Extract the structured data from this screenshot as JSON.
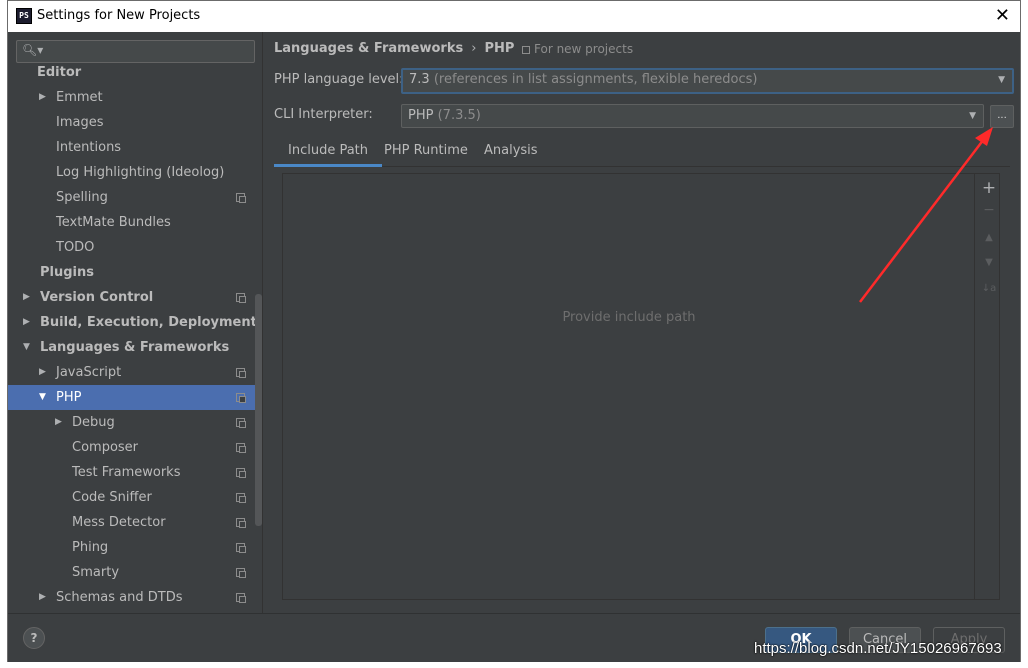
{
  "window": {
    "app_icon": "PS",
    "title": "Settings for New Projects",
    "close_icon": "close-icon"
  },
  "sidebar": {
    "search_placeholder": "",
    "items": [
      {
        "label": "Editor",
        "level": 0,
        "bold": true
      },
      {
        "label": "Emmet",
        "level": 1,
        "arrow": "collapsed"
      },
      {
        "label": "Images",
        "level": 1
      },
      {
        "label": "Intentions",
        "level": 1
      },
      {
        "label": "Log Highlighting (Ideolog)",
        "level": 1
      },
      {
        "label": "Spelling",
        "level": 1,
        "project_icon": true
      },
      {
        "label": "TextMate Bundles",
        "level": 1
      },
      {
        "label": "TODO",
        "level": 1
      },
      {
        "label": "Plugins",
        "level": 0,
        "bold": true
      },
      {
        "label": "Version Control",
        "level": 0,
        "bold": true,
        "arrow": "collapsed",
        "project_icon": true
      },
      {
        "label": "Build, Execution, Deployment",
        "level": 0,
        "bold": true,
        "arrow": "collapsed"
      },
      {
        "label": "Languages & Frameworks",
        "level": 0,
        "bold": true,
        "arrow": "expanded"
      },
      {
        "label": "JavaScript",
        "level": 1,
        "arrow": "collapsed",
        "project_icon": true
      },
      {
        "label": "PHP",
        "level": 1,
        "arrow": "expanded",
        "project_icon": true,
        "selected": true
      },
      {
        "label": "Debug",
        "level": 2,
        "arrow": "collapsed",
        "project_icon": true
      },
      {
        "label": "Composer",
        "level": 2,
        "project_icon": true
      },
      {
        "label": "Test Frameworks",
        "level": 2,
        "project_icon": true
      },
      {
        "label": "Code Sniffer",
        "level": 2,
        "project_icon": true
      },
      {
        "label": "Mess Detector",
        "level": 2,
        "project_icon": true
      },
      {
        "label": "Phing",
        "level": 2,
        "project_icon": true
      },
      {
        "label": "Smarty",
        "level": 2,
        "project_icon": true
      },
      {
        "label": "Schemas and DTDs",
        "level": 1,
        "arrow": "collapsed",
        "project_icon": true
      }
    ]
  },
  "main": {
    "breadcrumb": {
      "parent": "Languages & Frameworks",
      "separator": "›",
      "current": "PHP"
    },
    "for_new_projects": "For new projects",
    "php_level": {
      "label": "PHP language level:",
      "value": "7.3",
      "detail": "(references in list assignments, flexible heredocs)"
    },
    "cli": {
      "label": "CLI Interpreter:",
      "value": "PHP",
      "detail": "(7.3.5)",
      "more_button": "..."
    },
    "tabs": [
      "Include Path",
      "PHP Runtime",
      "Analysis"
    ],
    "active_tab": "Include Path",
    "include_path": {
      "empty_text": "Provide include path",
      "tools": [
        "+",
        "−",
        "▲",
        "▼",
        "↓a"
      ]
    }
  },
  "footer": {
    "help": "?",
    "ok": "OK",
    "cancel": "Cancel",
    "apply": "Apply"
  },
  "watermark": "https://blog.csdn.net/JY15026967693",
  "colors": {
    "panel": "#3c3f41",
    "selection": "#4b6eaf",
    "accent": "#4a88c7",
    "annotation_arrow": "#ff2a2a"
  }
}
